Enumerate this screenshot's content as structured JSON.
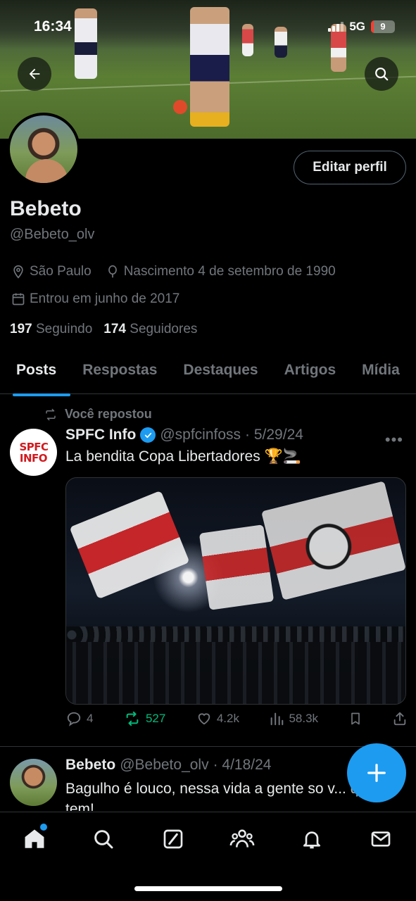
{
  "status_bar": {
    "time": "16:34",
    "network": "5G",
    "battery": "9"
  },
  "header": {
    "back_icon": "arrow-left-icon",
    "search_icon": "search-icon"
  },
  "profile": {
    "name": "Bebeto",
    "handle": "@Bebeto_olv",
    "edit_label": "Editar perfil",
    "location": "São Paulo",
    "birth": "Nascimento 4 de setembro de 1990",
    "joined": "Entrou em junho de 2017",
    "following_count": "197",
    "following_label": "Seguindo",
    "followers_count": "174",
    "followers_label": "Seguidores"
  },
  "tabs": [
    {
      "label": "Posts",
      "active": true
    },
    {
      "label": "Respostas",
      "active": false
    },
    {
      "label": "Destaques",
      "active": false
    },
    {
      "label": "Artigos",
      "active": false
    },
    {
      "label": "Mídia",
      "active": false
    }
  ],
  "posts": [
    {
      "repost_label": "Você repostou",
      "avatar_text": "SPFC INFO",
      "author": "SPFC Info",
      "handle": "@spfcinfoss",
      "date": "· 5/29/24",
      "text": "La bendita Copa Libertadores 🏆🚬",
      "replies": "4",
      "reposts": "527",
      "likes": "4.2k",
      "views": "58.3k"
    },
    {
      "author": "Bebeto",
      "handle": "@Bebeto_olv",
      "date": "· 4/18/24",
      "text": "Bagulho é louco, nessa vida a gente so v... que tem!"
    }
  ],
  "colors": {
    "accent": "#1d9bf0",
    "repost_green": "#00ba7c",
    "muted": "#71767b",
    "background": "#000000"
  },
  "bottom_nav": [
    "home-icon",
    "search-icon",
    "grok-icon",
    "communities-icon",
    "notifications-icon",
    "messages-icon"
  ]
}
